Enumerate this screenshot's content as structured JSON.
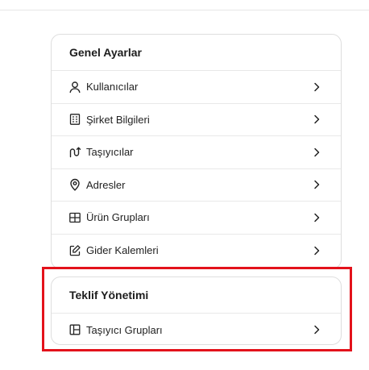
{
  "general": {
    "title": "Genel Ayarlar",
    "items": [
      {
        "label": "Kullanıcılar",
        "icon": "user-icon"
      },
      {
        "label": "Şirket Bilgileri",
        "icon": "building-icon"
      },
      {
        "label": "Taşıyıcılar",
        "icon": "route-icon"
      },
      {
        "label": "Adresler",
        "icon": "map-pin-icon"
      },
      {
        "label": "Ürün Grupları",
        "icon": "grid-icon"
      },
      {
        "label": "Gider Kalemleri",
        "icon": "note-edit-icon"
      }
    ]
  },
  "offer": {
    "title": "Teklif Yönetimi",
    "items": [
      {
        "label": "Taşıyıcı Grupları",
        "icon": "layout-icon"
      }
    ]
  },
  "colors": {
    "highlight": "#e3121b",
    "border": "#dedede",
    "text": "#222222"
  }
}
